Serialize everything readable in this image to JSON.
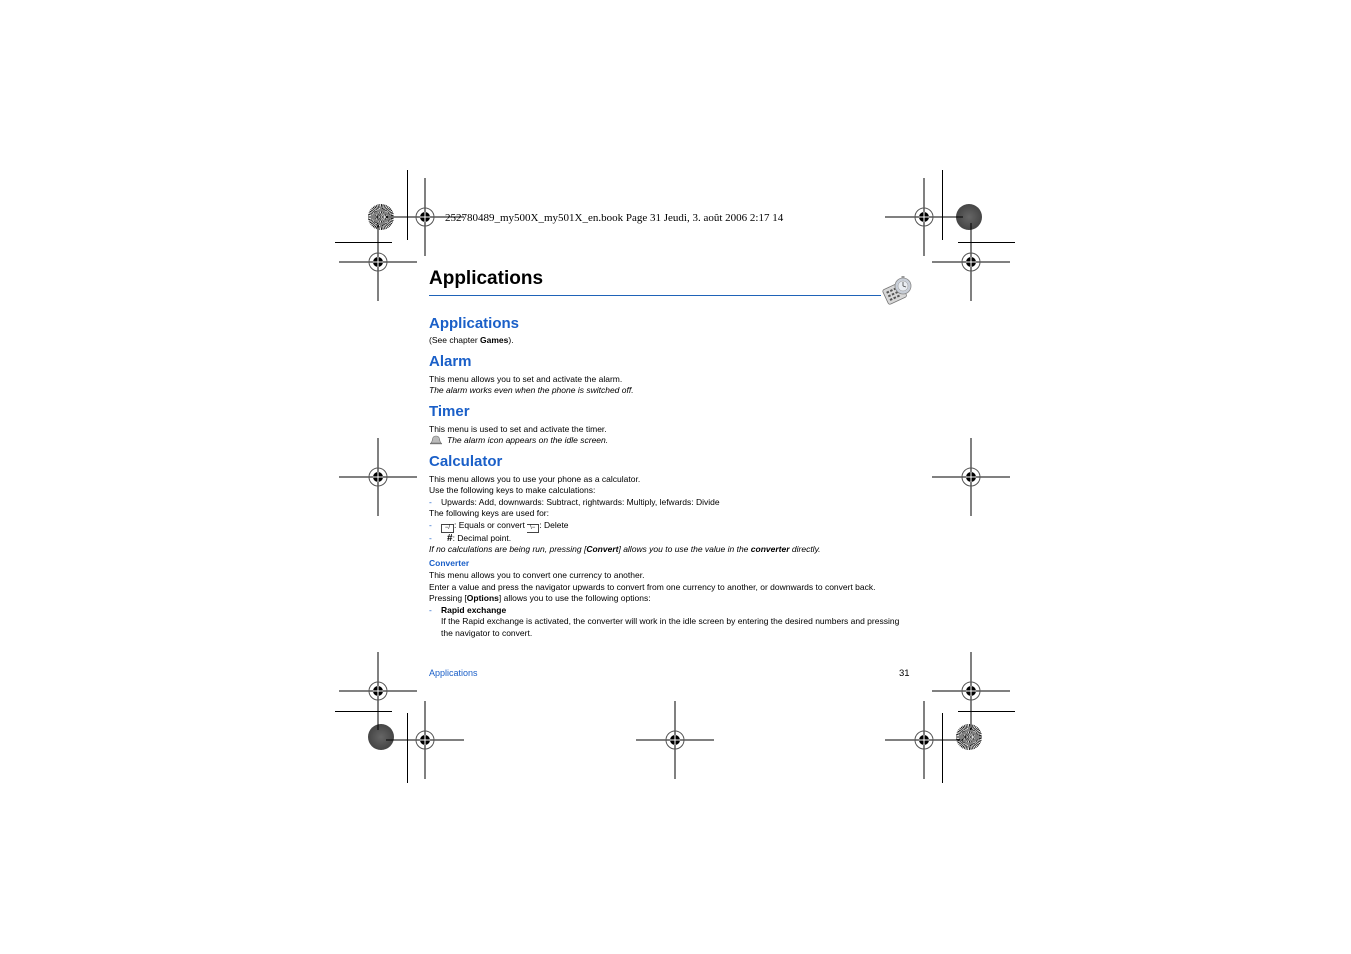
{
  "print_header": "252780489_my500X_my501X_en.book  Page 31  Jeudi, 3. août 2006  2:17 14",
  "chapter": {
    "title": "Applications",
    "icon": "applications-chapter-icon"
  },
  "sections": {
    "applications": {
      "heading": "Applications",
      "text_prefix": "(See chapter ",
      "text_bold": "Games",
      "text_suffix": ")."
    },
    "alarm": {
      "heading": "Alarm",
      "text": "This menu allows you to set and activate the alarm.",
      "note": "The alarm works even when the phone is switched off."
    },
    "timer": {
      "heading": "Timer",
      "text": "This menu is used to set and activate the timer.",
      "note_icon": "bell-icon",
      "note": "The alarm icon appears on the idle screen."
    },
    "calculator": {
      "heading": "Calculator",
      "text1": "This menu allows you to use your phone as a calculator.",
      "text2": "Use the following keys to make calculations:",
      "bullet1": "Upwards: Add, downwards: Subtract, rightwards: Multiply, lefwards: Divide",
      "text3": "The following keys are used for:",
      "bullet2_a": ": Equals or convert ",
      "bullet2_b": ": Delete",
      "bullet3_key": "#",
      "bullet3": ": Decimal point.",
      "note_a": "If no calculations are being run, pressing [",
      "note_bold1": "Convert",
      "note_b": "] allows you to use the value in the ",
      "note_bold2": "converter",
      "note_c": " directly.",
      "dash": "-"
    },
    "converter": {
      "heading": "Converter",
      "text1": "This menu allows you to convert one currency to another.",
      "text2": "Enter a value and press the navigator upwards to convert from one currency to another, or downwards to convert back.",
      "text3_a": "Pressing [",
      "text3_bold": "Options",
      "text3_b": "] allows you to use the following options:",
      "option_title": "Rapid exchange",
      "option_text": "If the Rapid exchange is activated, the converter will work in the idle screen by entering the desired numbers and pressing the navigator to convert."
    }
  },
  "footer": {
    "section": "Applications",
    "page_number": "31"
  },
  "colors": {
    "heading_blue": "#1a5fc8",
    "rule_blue": "#1f63b8"
  }
}
